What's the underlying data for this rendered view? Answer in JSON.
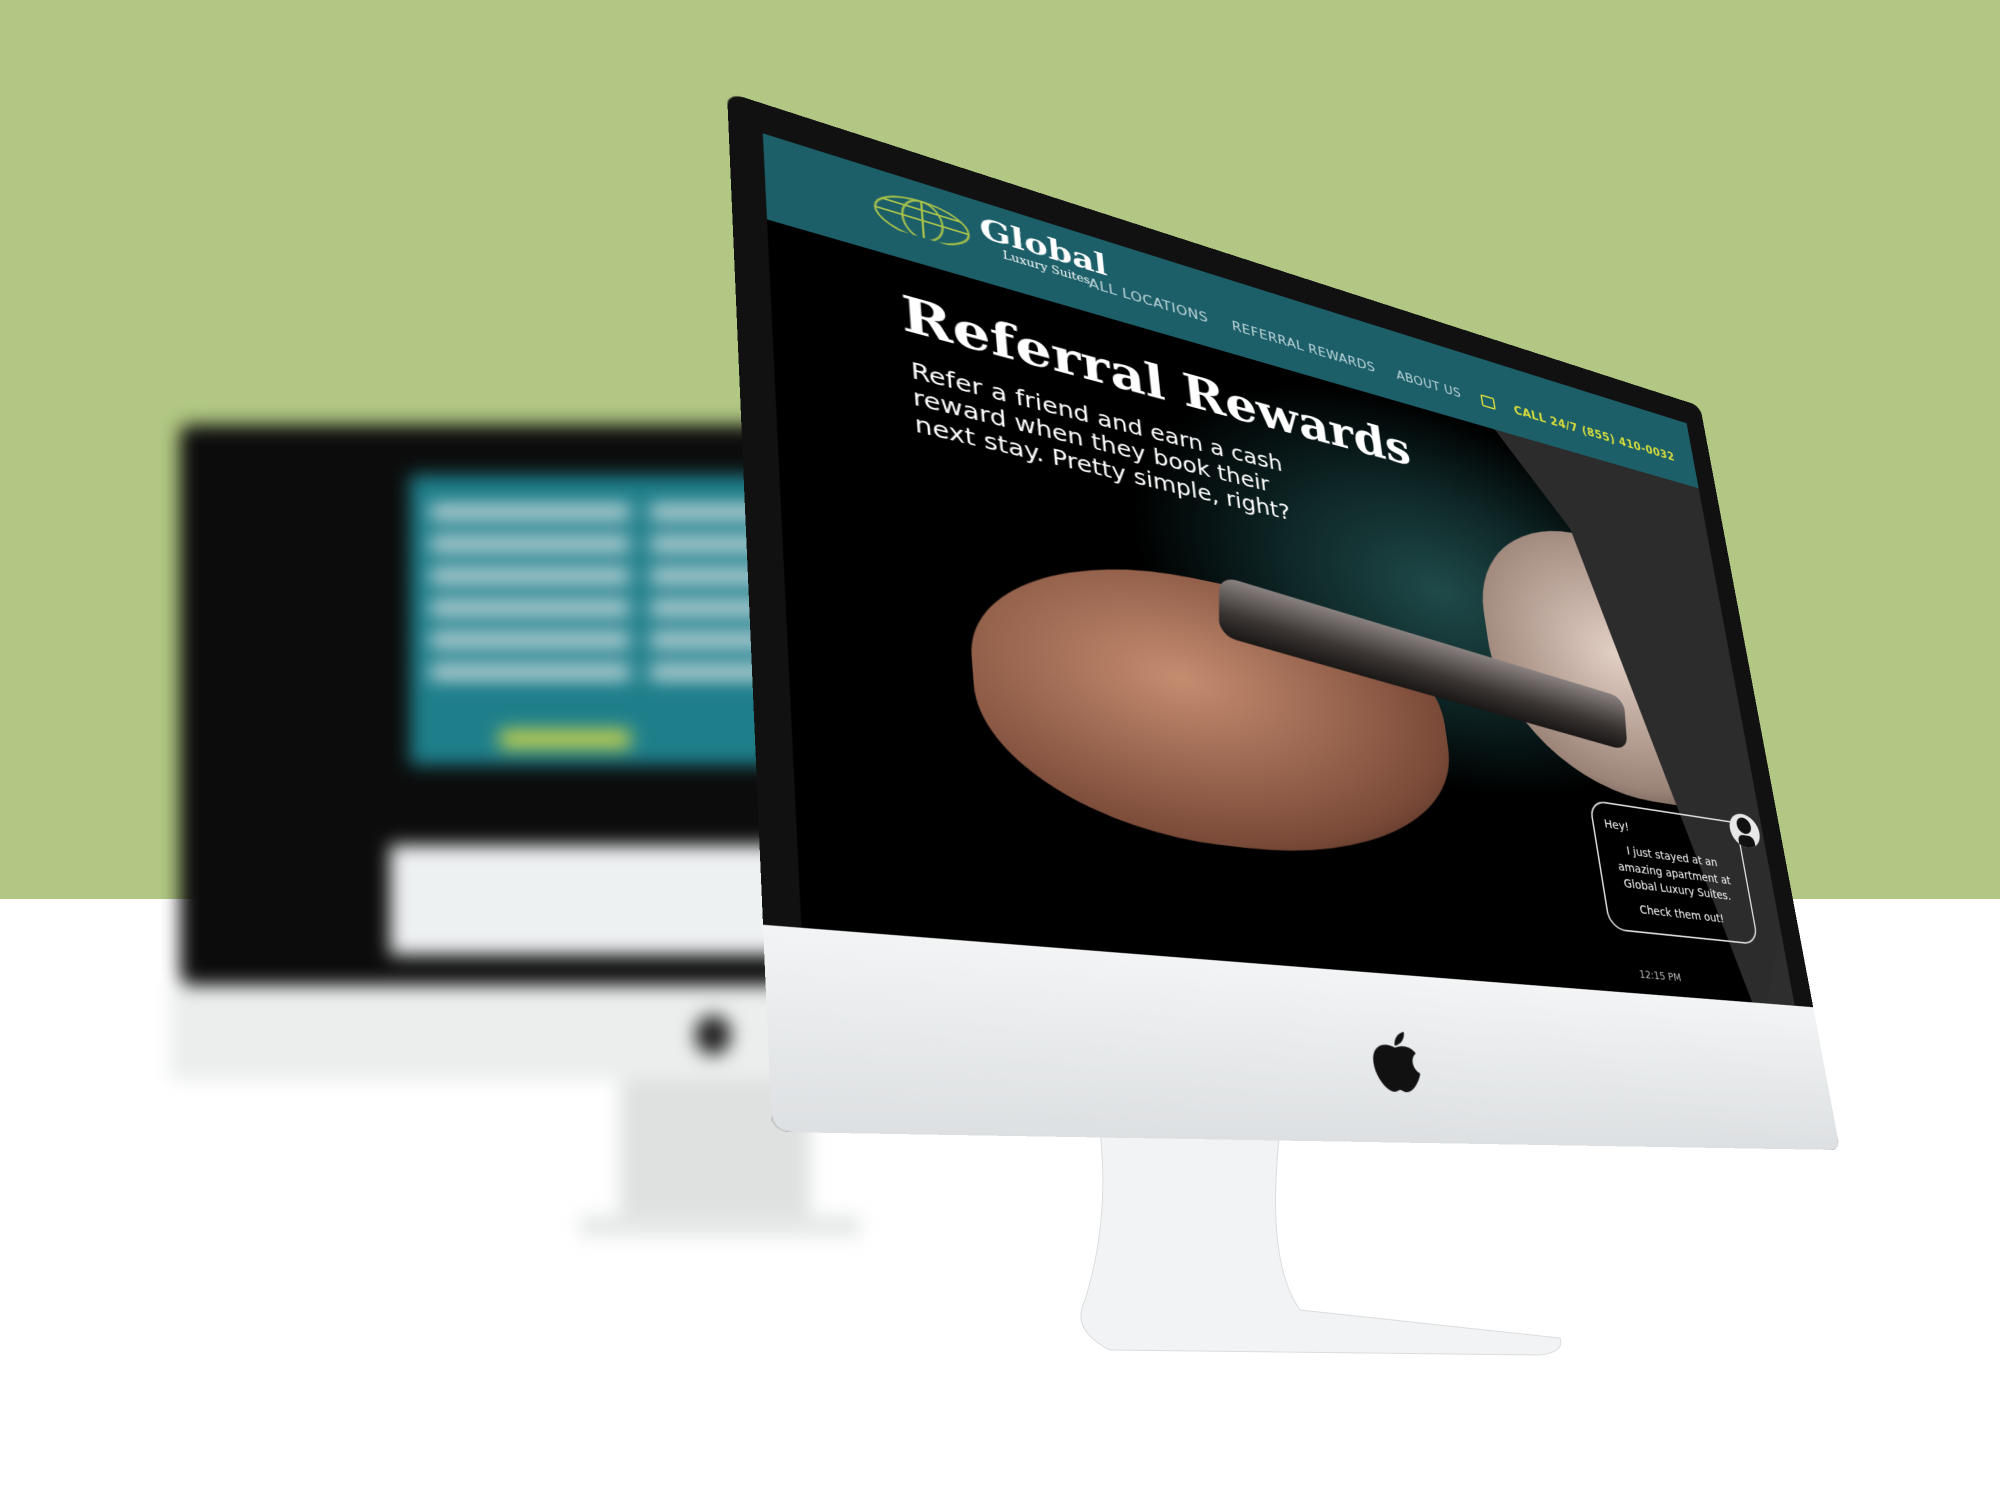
{
  "colors": {
    "background_top": "#b1c783",
    "background_bottom": "#ffffff",
    "nav": "#1c5f69",
    "accent": "#d6dc3b"
  },
  "site": {
    "logo": {
      "name": "Global",
      "tagline": "Luxury Suites",
      "icon": "globe-icon"
    },
    "nav": {
      "items": [
        {
          "label": "ALL LOCATIONS"
        },
        {
          "label": "REFERRAL REWARDS"
        },
        {
          "label": "ABOUT US"
        }
      ],
      "phone_icon": "suitcase-icon",
      "call": "CALL 24/7 (855) 410-0032"
    },
    "hero": {
      "title": "Referral Rewards",
      "subtitle": "Refer a friend and earn a cash reward when they book their next stay. Pretty simple, right?"
    },
    "chat": {
      "greeting": "Hey!",
      "message": "I just stayed at an amazing apartment at Global Luxury Suites.",
      "cta": "Check them out!",
      "time": "12:15 PM",
      "avatar_icon": "person-avatar-icon"
    }
  }
}
